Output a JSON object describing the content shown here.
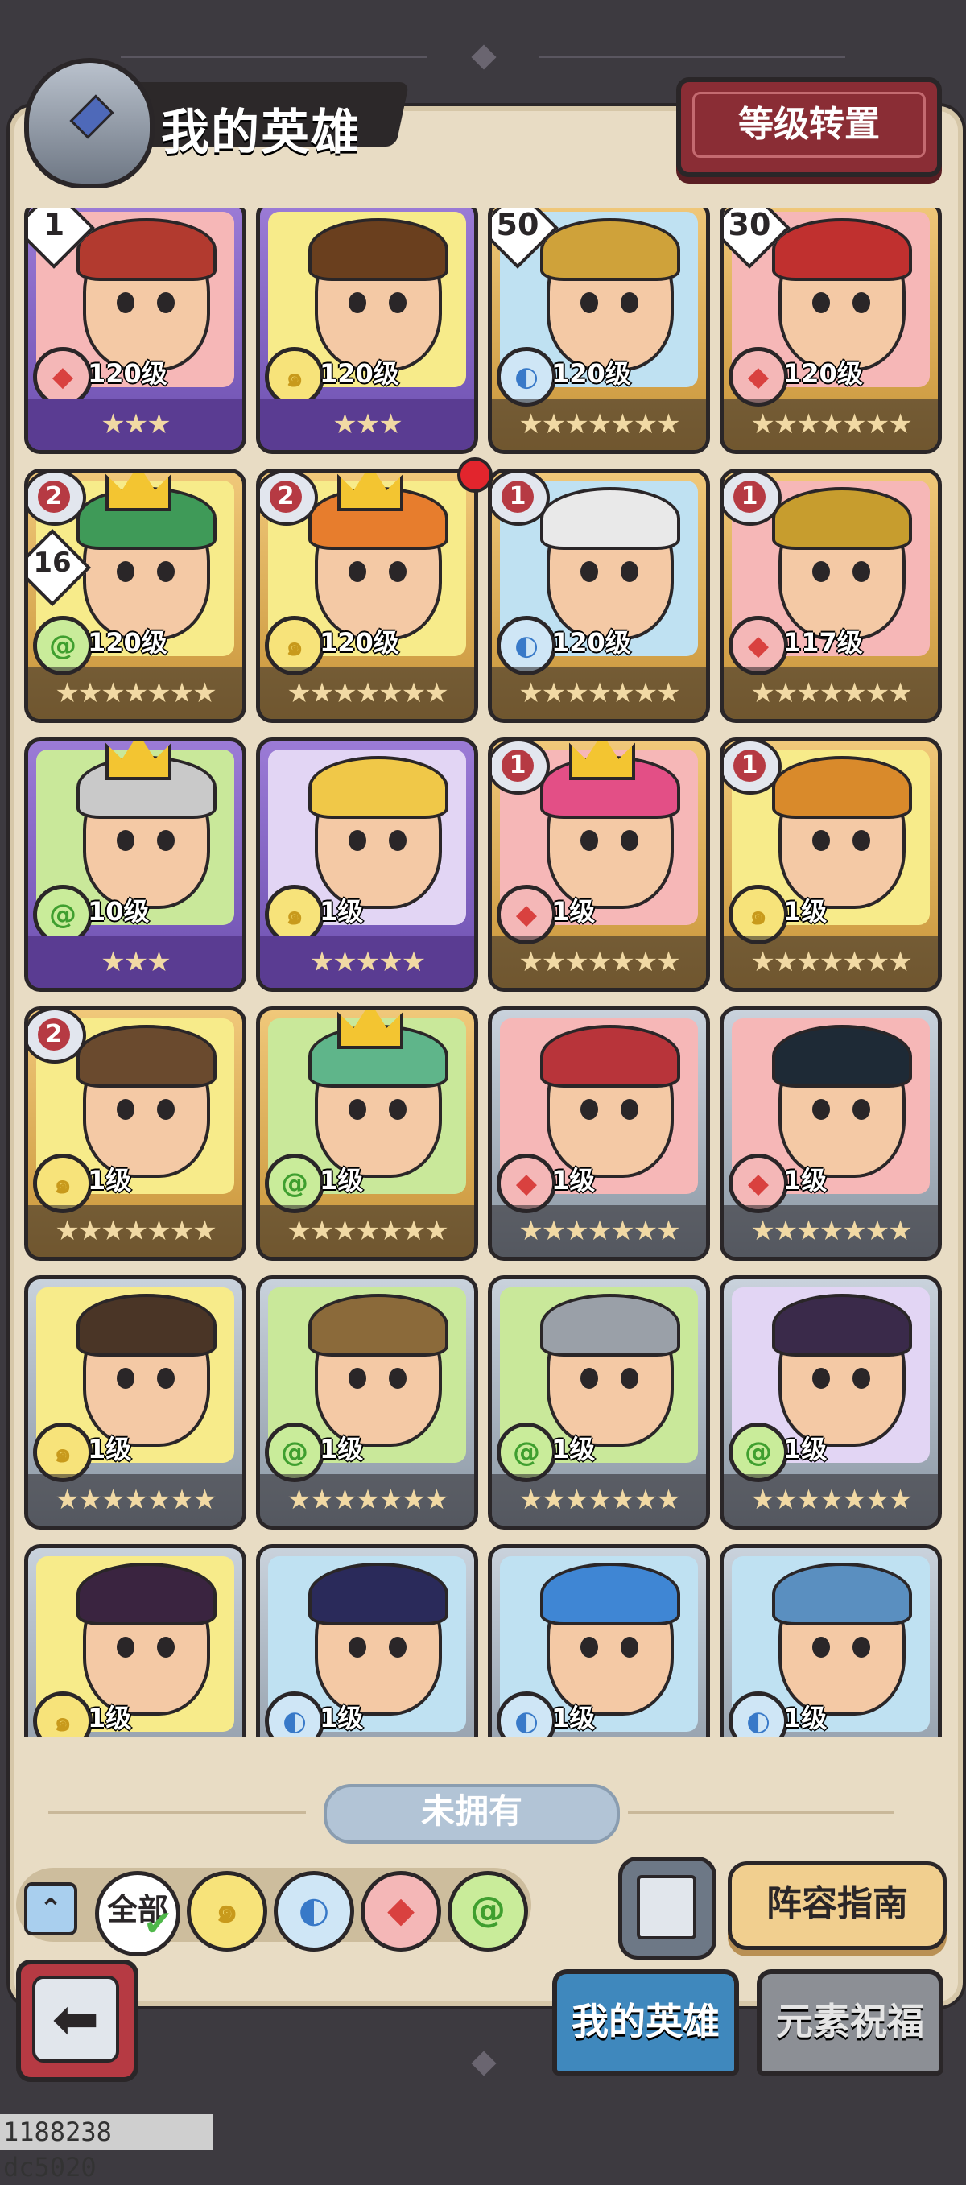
{
  "header": {
    "title": "我的英雄",
    "level_transfer_label": "等级转置"
  },
  "heroes": [
    {
      "level": "120级",
      "element": "fire",
      "stars": "★★★",
      "frame": "purple",
      "bg": "pink",
      "hair": "#b23a2f",
      "badge": "1"
    },
    {
      "level": "120级",
      "element": "earth",
      "stars": "★★★",
      "frame": "purple",
      "bg": "yellow",
      "hair": "#6a3f1e"
    },
    {
      "level": "120级",
      "element": "water",
      "stars": "★★★★★★★",
      "frame": "gold",
      "bg": "blue",
      "hair": "#cfa23a",
      "badge": "50"
    },
    {
      "level": "120级",
      "element": "fire",
      "stars": "★★★★★★★",
      "frame": "gold",
      "bg": "pink",
      "hair": "#c0302f",
      "badge": "30"
    },
    {
      "level": "120级",
      "element": "wind",
      "stars": "★★★★★★★",
      "frame": "gold",
      "bg": "yellow",
      "hair": "#3f9a58",
      "wing": "2",
      "sub_badge": "16",
      "crown": true
    },
    {
      "level": "120级",
      "element": "earth",
      "stars": "★★★★★★★",
      "frame": "gold",
      "bg": "yellow",
      "hair": "#e77d2d",
      "wing": "2",
      "crown": true,
      "red_dot": true
    },
    {
      "level": "120级",
      "element": "water",
      "stars": "★★★★★★★",
      "frame": "gold",
      "bg": "blue",
      "hair": "#e9e9e9",
      "wing": "1"
    },
    {
      "level": "117级",
      "element": "fire",
      "stars": "★★★★★★★",
      "frame": "gold",
      "bg": "pink",
      "hair": "#c79d2e",
      "wing": "1"
    },
    {
      "level": "10级",
      "element": "wind",
      "stars": "★★★",
      "frame": "purple",
      "bg": "green",
      "hair": "#c9c9c9",
      "crown": true
    },
    {
      "level": "1级",
      "element": "earth",
      "stars": "★★★★★",
      "frame": "purple",
      "bg": "lav",
      "hair": "#f0c848"
    },
    {
      "level": "1级",
      "element": "fire",
      "stars": "★★★★★★★",
      "frame": "gold",
      "bg": "pink",
      "hair": "#e34f86",
      "wing": "1",
      "crown": true
    },
    {
      "level": "1级",
      "element": "earth",
      "stars": "★★★★★★★",
      "frame": "gold",
      "bg": "yellow",
      "hair": "#d98a2b",
      "wing": "1"
    },
    {
      "level": "1级",
      "element": "earth",
      "stars": "★★★★★★★",
      "frame": "gold",
      "bg": "yellow",
      "hair": "#6a4a2e",
      "wing": "2"
    },
    {
      "level": "1级",
      "element": "wind",
      "stars": "★★★★★★★",
      "frame": "gold",
      "bg": "green",
      "hair": "#5fb58a",
      "crown": true
    },
    {
      "level": "1级",
      "element": "fire",
      "stars": "★★★★★★★",
      "frame": "silver",
      "bg": "pink",
      "hair": "#b8343a"
    },
    {
      "level": "1级",
      "element": "fire",
      "stars": "★★★★★★★",
      "frame": "silver",
      "bg": "pink",
      "hair": "#1e2a36"
    },
    {
      "level": "1级",
      "element": "earth",
      "stars": "★★★★★★★",
      "frame": "silver",
      "bg": "yellow",
      "hair": "#4a3526"
    },
    {
      "level": "1级",
      "element": "wind",
      "stars": "★★★★★★★",
      "frame": "silver",
      "bg": "green",
      "hair": "#8b6a3a"
    },
    {
      "level": "1级",
      "element": "wind",
      "stars": "★★★★★★★",
      "frame": "silver",
      "bg": "green",
      "hair": "#9aa0a8"
    },
    {
      "level": "1级",
      "element": "wind",
      "stars": "★★★★★★★",
      "frame": "silver",
      "bg": "lav",
      "hair": "#3a2a4a"
    },
    {
      "level": "1级",
      "element": "earth",
      "stars": "★★★★★★★",
      "frame": "silver",
      "bg": "yellow",
      "hair": "#3a2440"
    },
    {
      "level": "1级",
      "element": "water",
      "stars": "★★★★★★★",
      "frame": "silver",
      "bg": "blue",
      "hair": "#2a2a5a"
    },
    {
      "level": "1级",
      "element": "water",
      "stars": "★★★★★★★",
      "frame": "silver",
      "bg": "blue",
      "hair": "#3f86d4"
    },
    {
      "level": "1级",
      "element": "water",
      "stars": "★★★★★★★",
      "frame": "silver",
      "bg": "blue",
      "hair": "#5a8fc0"
    }
  ],
  "not_owned_label": "未拥有",
  "filters": {
    "all_label": "全部",
    "collapse_icon": "⌃"
  },
  "guide_button_label": "阵容指南",
  "tabs": {
    "my_heroes": "我的英雄",
    "element_blessing": "元素祝福"
  },
  "footer_id": "1188238 dc5020",
  "colors": {
    "fire": "#d9413f",
    "earth": "#c89a1c",
    "water": "#3879c8",
    "wind": "#3f9f2f"
  }
}
